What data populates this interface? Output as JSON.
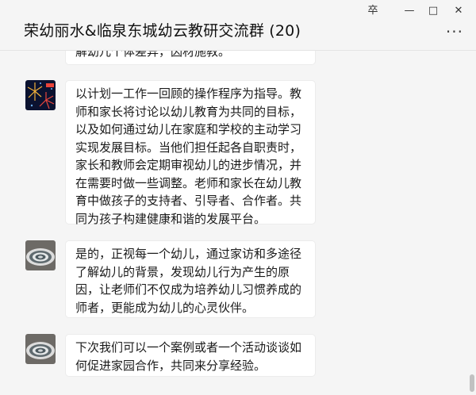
{
  "window": {
    "title": "荣幼丽水&临泉东城幼云教研交流群 (20)",
    "controls": {
      "pin": "卒",
      "minimize": "—",
      "maximize": "□",
      "close": "✕"
    },
    "more": "···"
  },
  "messages": [
    {
      "sender_avatar": "fireworks-avatar",
      "text": "解幼儿个体差异，因材施教。",
      "partial": true
    },
    {
      "sender_avatar": "fireworks-avatar",
      "text": "以计划一工作一回顾的操作程序为指导。教师和家长将讨论以幼儿教育为共同的目标，以及如何通过幼儿在家庭和学校的主动学习实现发展目标。当他们担任起各自职责时，家长和教师会定期审视幼儿的进步情况，并在需要时做一些调整。老师和家长在幼儿教育中做孩子的支持者、引导者、合作者。共同为孩子构建健康和谐的发展平台。"
    },
    {
      "sender_avatar": "ripple-avatar",
      "text": "是的，正视每一个幼儿，通过家访和多途径了解幼儿的背景，发现幼儿行为产生的原因，让老师们不仅成为培养幼儿习惯养成的师者，更能成为幼儿的心灵伙伴。"
    },
    {
      "sender_avatar": "ripple-avatar",
      "text": "下次我们可以一个案例或者一个活动谈谈如何促进家园合作，共同来分享经验。"
    }
  ],
  "colors": {
    "bubble": "#ffffff",
    "background": "#f5f5f5",
    "scrollbar": "#c1c1c1"
  }
}
